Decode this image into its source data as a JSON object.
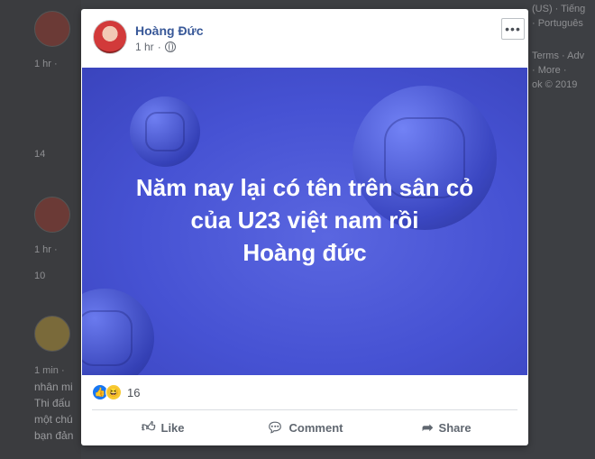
{
  "background": {
    "left_posts": [
      {
        "meta": "1 hr · ",
        "reaction_count": "14"
      },
      {
        "meta": "1 hr · ",
        "reaction_count": "10"
      },
      {
        "meta": "1 min · ",
        "lines": [
          "nhân mi",
          "Thi đấu",
          "một chú",
          "bạn đản"
        ]
      }
    ],
    "right_column": [
      "(US) · Tiếng",
      "· Português",
      "Terms · Adv",
      "· More ·",
      "ok © 2019"
    ]
  },
  "post": {
    "author": "Hoàng Đức",
    "time": "1 hr",
    "more_label": "•••",
    "image_text": [
      "Năm nay lại có tên trên sân cỏ",
      "của U23 việt nam rồi",
      "Hoàng đức"
    ],
    "reaction_count": "16",
    "actions": {
      "like": "Like",
      "comment": "Comment",
      "share": "Share"
    }
  },
  "colors": {
    "accent": "#385898",
    "image_bg": "#4652d3",
    "like_blue": "#1877f2"
  }
}
